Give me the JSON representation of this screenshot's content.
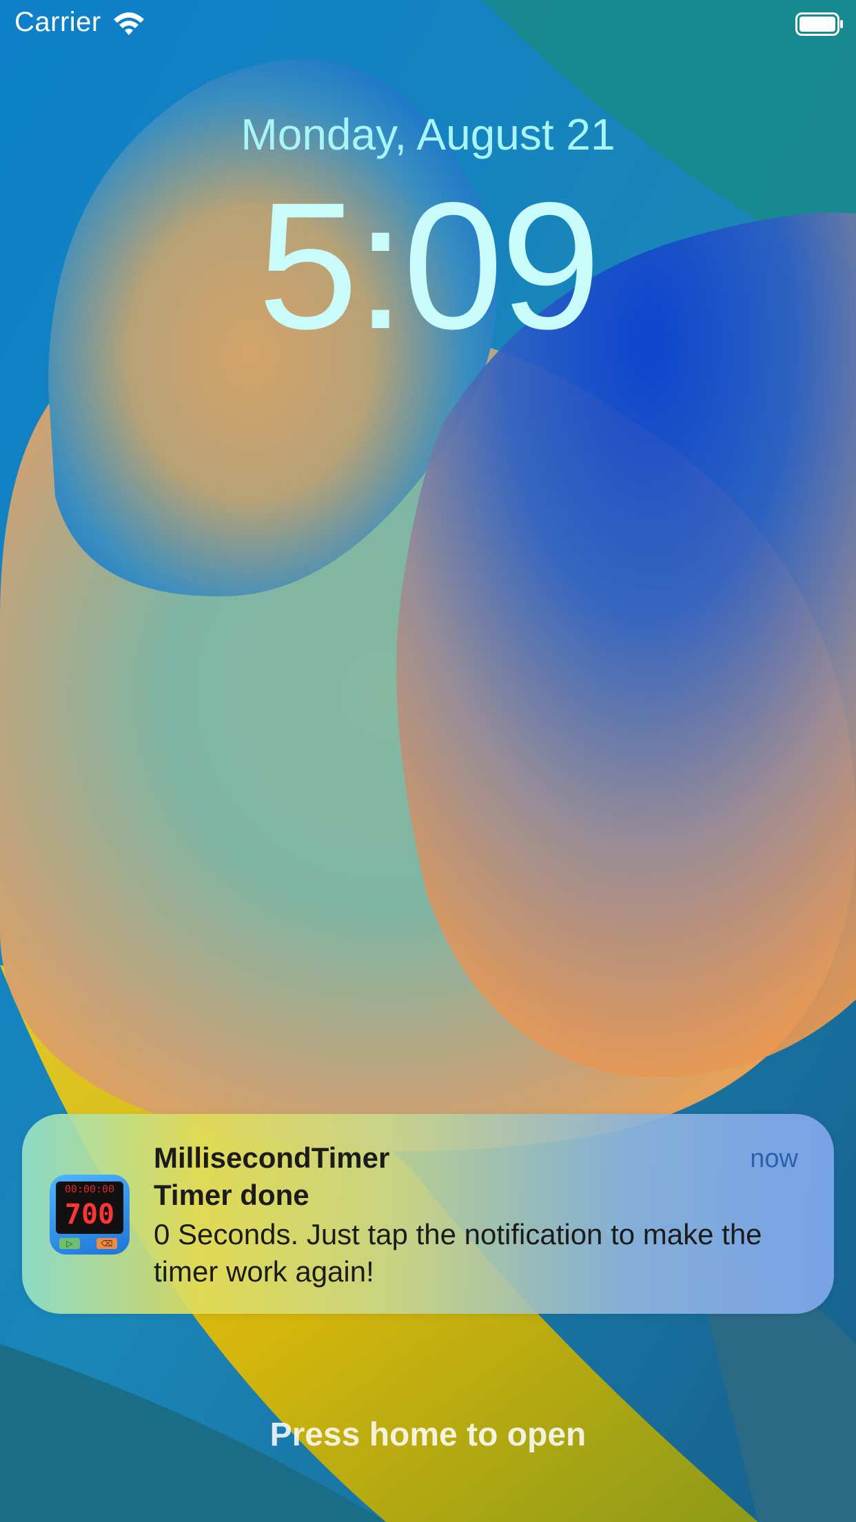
{
  "status_bar": {
    "carrier": "Carrier",
    "wifi_icon": "wifi-icon",
    "battery_icon": "battery-icon"
  },
  "lock_screen": {
    "date": "Monday, August 21",
    "time": "5:09",
    "hint": "Press home to open"
  },
  "notification": {
    "app_name": "MillisecondTimer",
    "timestamp": "now",
    "title": "Timer done",
    "body": "0 Seconds. Just tap the notification to make the timer work again!",
    "icon": {
      "name": "millisecond-timer-app-icon",
      "top_digits": "00:00:00",
      "big_digits": "700"
    }
  },
  "colors": {
    "date": "#a8f5f7",
    "time": "#c8fbf9",
    "timestamp": "#2c5fae"
  }
}
